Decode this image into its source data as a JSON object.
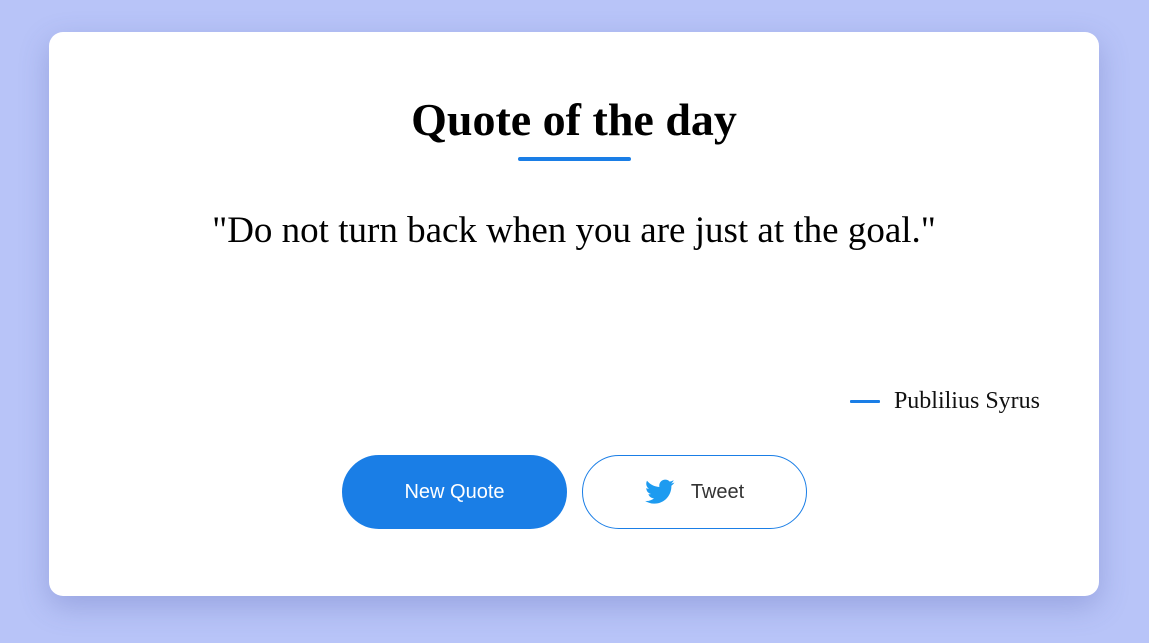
{
  "page": {
    "title": "Quote of the day"
  },
  "quote": {
    "text": "\"Do not turn back when you are just at the goal.\"",
    "author": "Publilius Syrus"
  },
  "buttons": {
    "new_quote_label": "New Quote",
    "tweet_label": "Tweet",
    "tweet_icon": "twitter-bird-icon"
  },
  "colors": {
    "background": "#b8c4f8",
    "card": "#ffffff",
    "accent": "#1a7ee6",
    "twitter": "#1d9bf0"
  }
}
